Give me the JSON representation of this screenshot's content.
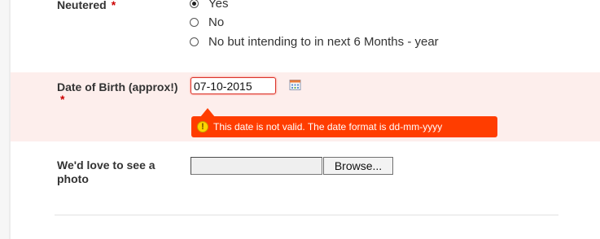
{
  "neutered": {
    "label": "Neutered",
    "required_mark": "*",
    "options": [
      {
        "label": "Yes",
        "checked": true
      },
      {
        "label": "No",
        "checked": false
      },
      {
        "label": "No but intending to in next 6 Months - year",
        "checked": false
      }
    ]
  },
  "dob": {
    "label": "Date of Birth (approx!)",
    "required_mark": "*",
    "value": "07-10-2015",
    "calendar_icon": "calendar-icon",
    "error_message": "This date is not valid. The date format is dd-mm-yyyy",
    "error_icon": "warning-icon"
  },
  "photo": {
    "label_line1": "We'd love to see a",
    "label_line2": "photo",
    "browse_label": "Browse..."
  },
  "colors": {
    "error_bg": "#ff3d00",
    "error_band": "#fdeeec",
    "required": "#cc0000"
  }
}
